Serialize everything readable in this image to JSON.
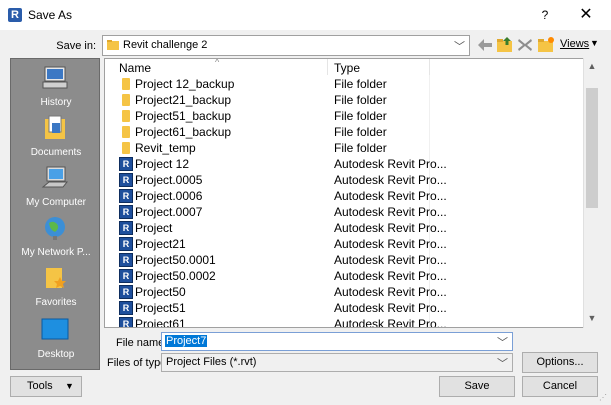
{
  "window": {
    "title": "Save As",
    "help": "?",
    "close": "✕"
  },
  "toolbar": {
    "save_in_label": "Save in:",
    "save_in_value": "Revit challenge 2",
    "views_label": "Views"
  },
  "places": [
    {
      "label": "History",
      "icon": "history-icon"
    },
    {
      "label": "Documents",
      "icon": "documents-icon"
    },
    {
      "label": "My Computer",
      "icon": "computer-icon"
    },
    {
      "label": "My Network P...",
      "icon": "network-icon"
    },
    {
      "label": "Favorites",
      "icon": "favorites-icon"
    },
    {
      "label": "Desktop",
      "icon": "desktop-icon"
    }
  ],
  "columns": {
    "name": "Name",
    "type": "Type"
  },
  "files": [
    {
      "name": "Project 12_backup",
      "type": "File folder",
      "icon": "folder-icon"
    },
    {
      "name": "Project21_backup",
      "type": "File folder",
      "icon": "folder-icon"
    },
    {
      "name": "Project51_backup",
      "type": "File folder",
      "icon": "folder-icon"
    },
    {
      "name": "Project61_backup",
      "type": "File folder",
      "icon": "folder-icon"
    },
    {
      "name": "Revit_temp",
      "type": "File folder",
      "icon": "folder-icon"
    },
    {
      "name": "Project 12",
      "type": "Autodesk Revit Pro...",
      "icon": "revit-file-icon"
    },
    {
      "name": "Project.0005",
      "type": "Autodesk Revit Pro...",
      "icon": "revit-file-icon"
    },
    {
      "name": "Project.0006",
      "type": "Autodesk Revit Pro...",
      "icon": "revit-file-icon"
    },
    {
      "name": "Project.0007",
      "type": "Autodesk Revit Pro...",
      "icon": "revit-file-icon"
    },
    {
      "name": "Project",
      "type": "Autodesk Revit Pro...",
      "icon": "revit-file-icon"
    },
    {
      "name": "Project21",
      "type": "Autodesk Revit Pro...",
      "icon": "revit-file-icon"
    },
    {
      "name": "Project50.0001",
      "type": "Autodesk Revit Pro...",
      "icon": "revit-file-icon"
    },
    {
      "name": "Project50.0002",
      "type": "Autodesk Revit Pro...",
      "icon": "revit-file-icon"
    },
    {
      "name": "Project50",
      "type": "Autodesk Revit Pro...",
      "icon": "revit-file-icon"
    },
    {
      "name": "Project51",
      "type": "Autodesk Revit Pro...",
      "icon": "revit-file-icon"
    },
    {
      "name": "Project61",
      "type": "Autodesk Revit Pro...",
      "icon": "revit-file-icon"
    }
  ],
  "fields": {
    "file_name_label": "File name:",
    "file_name_value": "Project7",
    "files_of_type_label": "Files of type:",
    "files_of_type_value": "Project Files  (*.rvt)"
  },
  "buttons": {
    "options": "Options...",
    "save": "Save",
    "cancel": "Cancel",
    "tools": "Tools"
  },
  "colors": {
    "places_bg": "#8c8c8c",
    "selection": "#0078d7",
    "revit_icon": "#1e4f9c",
    "folder_icon": "#f5c445"
  }
}
